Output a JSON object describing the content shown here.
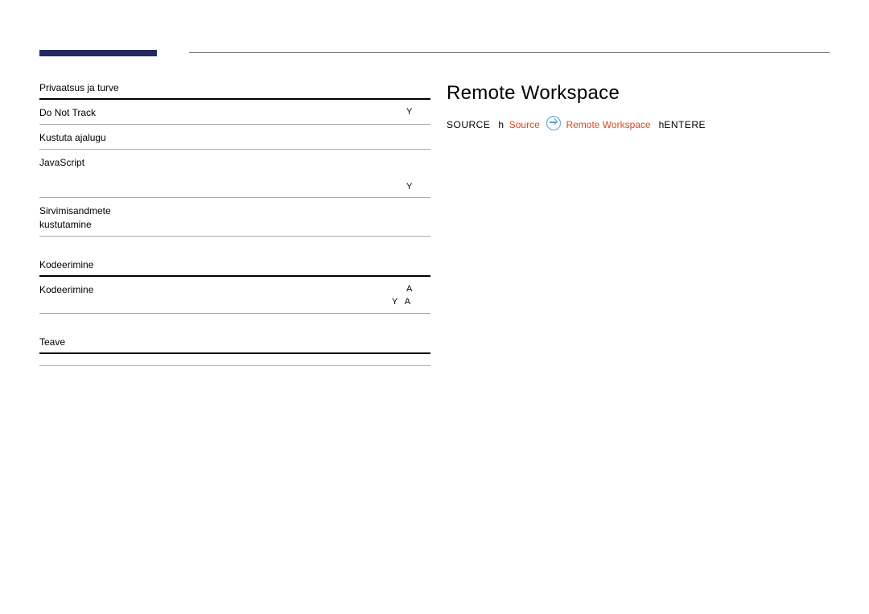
{
  "header": {
    "accent_color": "#222a5f"
  },
  "left": {
    "sections": [
      {
        "heading": "Privaatsus ja turve",
        "rows": [
          {
            "label": "Do Not Track",
            "mark": "Y"
          },
          {
            "label": "Kustuta ajalugu",
            "mark": ""
          },
          {
            "label": "JavaScript",
            "mark": ""
          },
          {
            "label": "",
            "mark": "Y"
          },
          {
            "label": "Sirvimisandmete\nkustutamine",
            "mark": ""
          }
        ]
      },
      {
        "heading": "Kodeerimine",
        "rows": [
          {
            "label": "Kodeerimine",
            "mark": "A",
            "sub": "Y   A"
          }
        ]
      },
      {
        "heading": "Teave",
        "rows": [
          {
            "label": "",
            "mark": ""
          }
        ]
      }
    ]
  },
  "right": {
    "title": "Remote Workspace",
    "instruction": {
      "source_label": "SOURCE",
      "arrow1": "h",
      "source_red": "Source",
      "icon": "remote-workspace-icon",
      "remote_red": "Remote Workspace",
      "arrow2": "h",
      "enter_label": "ENTERE"
    }
  }
}
